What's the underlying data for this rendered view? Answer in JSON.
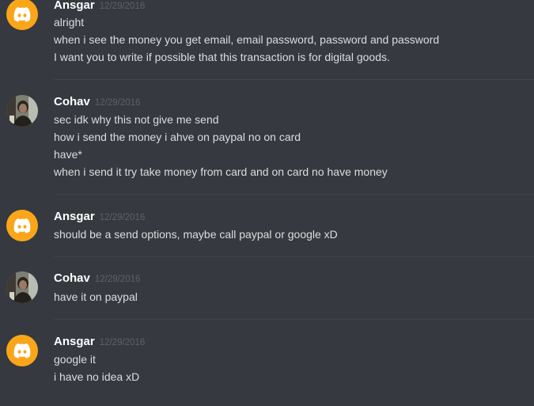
{
  "colors": {
    "background": "#36393f",
    "username": "#ffffff",
    "timestamp": "#5e6268",
    "message_text": "#dcddde",
    "discord_avatar": "#faa61a",
    "divider": "#40434a"
  },
  "messages": [
    {
      "author": "Ansgar",
      "timestamp": "12/29/2016",
      "avatar_icon": "discord-logo-icon",
      "lines": [
        "alright",
        "when i see the money you get email, email password, password and password",
        "I want you to write if possible that this transaction is for digital goods."
      ]
    },
    {
      "author": "Cohav",
      "timestamp": "12/29/2016",
      "avatar_icon": "user-photo",
      "lines": [
        "sec idk why this not give me send",
        "how i send the money i ahve on paypal no on card",
        "have*",
        "when i send it try take money from card and on card no have money"
      ]
    },
    {
      "author": "Ansgar",
      "timestamp": "12/29/2016",
      "avatar_icon": "discord-logo-icon",
      "lines": [
        "should be a send options, maybe call paypal or google xD"
      ]
    },
    {
      "author": "Cohav",
      "timestamp": "12/29/2016",
      "avatar_icon": "user-photo",
      "lines": [
        "have it on paypal"
      ]
    },
    {
      "author": "Ansgar",
      "timestamp": "12/29/2016",
      "avatar_icon": "discord-logo-icon",
      "lines": [
        "google it",
        "i have no idea xD"
      ]
    }
  ]
}
